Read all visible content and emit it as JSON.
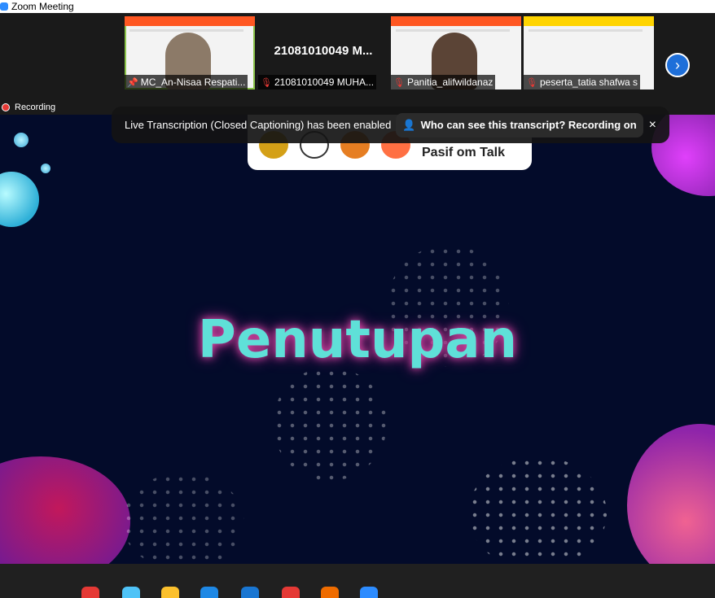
{
  "window": {
    "title": "Zoom Meeting"
  },
  "participants": [
    {
      "name": "MC_An-Nisaa Respati...",
      "muted": false,
      "pinned": true,
      "video": true
    },
    {
      "name": "21081010049 MUHA...",
      "display": "21081010049 M...",
      "muted": true,
      "video": false
    },
    {
      "name": "Panitia_alifwildanaz",
      "muted": true,
      "video": true
    },
    {
      "name": "peserta_tatia shafwa s",
      "muted": true,
      "video": true
    }
  ],
  "recording": {
    "label": "Recording"
  },
  "banner": {
    "message": "Live Transcription (Closed Captioning) has been enabled",
    "link": "Who can see this transcript? Recording on",
    "close": "×"
  },
  "slide": {
    "title": "Penutupan",
    "logo_text": "Pasif om Talk"
  },
  "icons": {
    "next": "chevron-right-icon",
    "mic_muted": "mic-muted-icon",
    "pin": "pin-icon"
  },
  "colors": {
    "title": "#5fe0d8",
    "glow": "#e04ba8",
    "slide_bg": "#030b2a",
    "accent": "#2d8cff",
    "muted": "#e53935"
  }
}
